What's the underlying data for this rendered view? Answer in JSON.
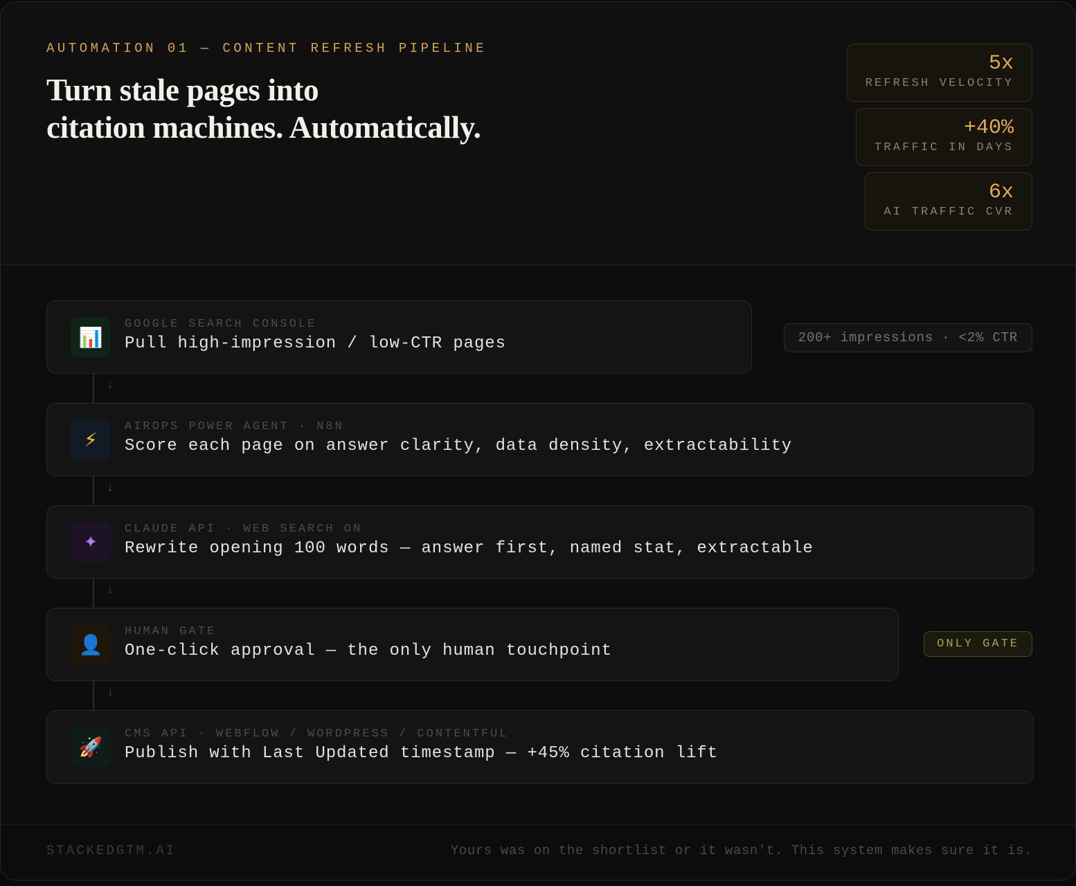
{
  "header": {
    "eyebrow": "AUTOMATION 01 — CONTENT REFRESH PIPELINE",
    "headline_line1": "Turn stale pages into",
    "headline_line2": "citation machines. Automatically."
  },
  "stats": [
    {
      "value": "5x",
      "label": "REFRESH VELOCITY"
    },
    {
      "value": "+40%",
      "label": "TRAFFIC IN DAYS"
    },
    {
      "value": "6x",
      "label": "AI TRAFFIC CVR"
    }
  ],
  "steps": [
    {
      "icon": "bar-chart-icon",
      "glyph": "📊",
      "source": "GOOGLE SEARCH CONSOLE",
      "action": "Pull high-impression / low-CTR pages",
      "tag": "200+ impressions · <2% CTR"
    },
    {
      "icon": "lightning-icon",
      "glyph": "⚡",
      "source": "AIROPS POWER AGENT · N8N",
      "action": "Score each page on answer clarity, data density, extractability"
    },
    {
      "icon": "sparkle-icon",
      "glyph": "✦",
      "source": "CLAUDE API · WEB SEARCH ON",
      "action": "Rewrite opening 100 words — answer first, named stat, extractable"
    },
    {
      "icon": "person-icon",
      "glyph": "👤",
      "source": "HUMAN GATE",
      "action": "One-click approval — the only human touchpoint",
      "tag": "ONLY GATE"
    },
    {
      "icon": "rocket-icon",
      "glyph": "🚀",
      "source": "CMS API · WEBFLOW / WORDPRESS / CONTENTFUL",
      "action": "Publish with Last Updated timestamp — +45% citation lift"
    }
  ],
  "arrow": "↓",
  "footer": {
    "brand": "STACKEDGTM.AI",
    "tagline": "Yours was on the shortlist or it wasn't. This system makes sure it is."
  },
  "colors": {
    "accent": "#d6a35a",
    "stat_value": "#e0a85e",
    "gate_tag": "#a8a45a",
    "background": "#0f0f0f"
  }
}
